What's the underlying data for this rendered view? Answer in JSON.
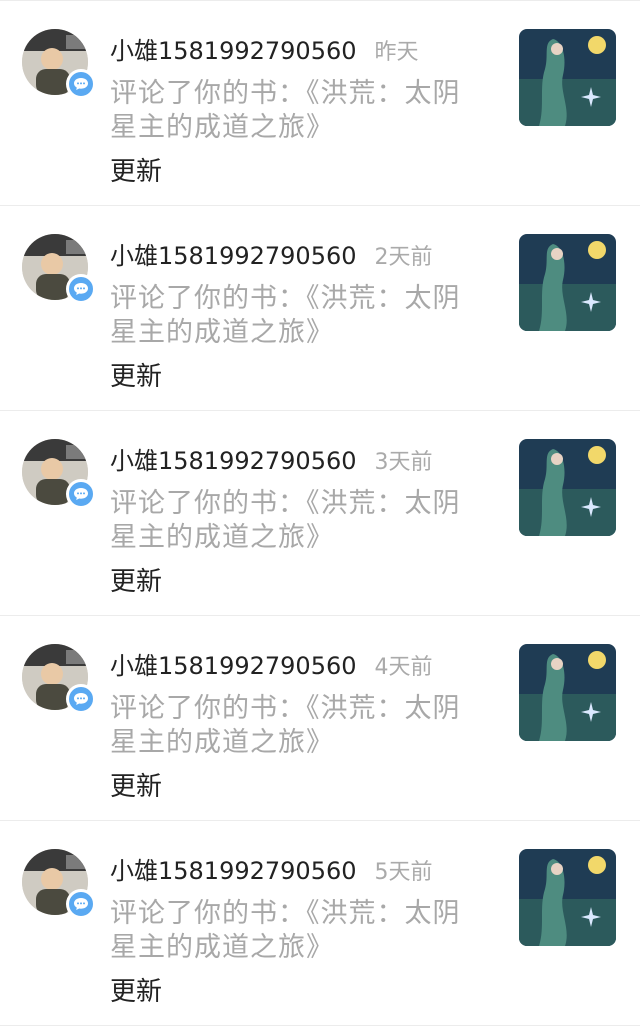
{
  "notifications": [
    {
      "username": "小雄1581992790560",
      "time": "昨天",
      "comment": "评论了你的书：《洪荒：太阴星主的成道之旅》",
      "action": "更新"
    },
    {
      "username": "小雄1581992790560",
      "time": "2天前",
      "comment": "评论了你的书：《洪荒：太阴星主的成道之旅》",
      "action": "更新"
    },
    {
      "username": "小雄1581992790560",
      "time": "3天前",
      "comment": "评论了你的书：《洪荒：太阴星主的成道之旅》",
      "action": "更新"
    },
    {
      "username": "小雄1581992790560",
      "time": "4天前",
      "comment": "评论了你的书：《洪荒：太阴星主的成道之旅》",
      "action": "更新"
    },
    {
      "username": "小雄1581992790560",
      "time": "5天前",
      "comment": "评论了你的书：《洪荒：太阴星主的成道之旅》",
      "action": "更新"
    }
  ],
  "icons": {
    "badge": "comment-bubble-icon"
  },
  "colors": {
    "badge": "#5aa9f2",
    "username": "#222222",
    "secondary_text": "#a8a8a8",
    "divider": "#ececec"
  }
}
